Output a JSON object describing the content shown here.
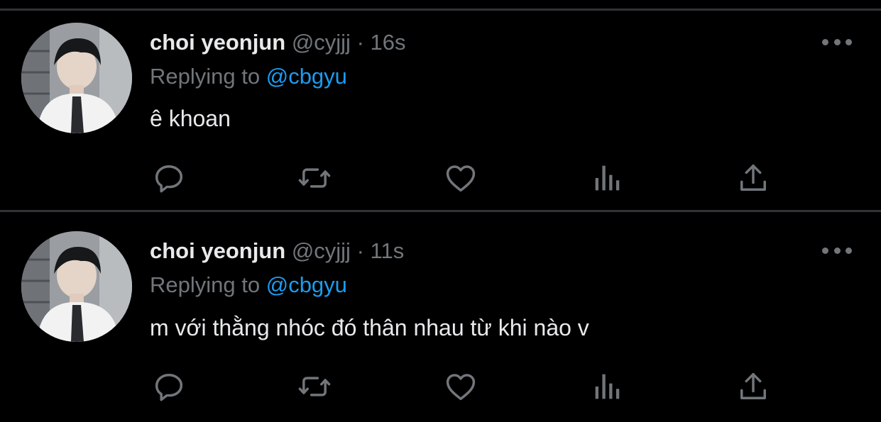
{
  "tweets": [
    {
      "name": "choi yeonjun",
      "handle": "@cyjjj",
      "separator": "·",
      "time": "16s",
      "replying_prefix": "Replying to",
      "replying_to": "@cbgyu",
      "text": "ê khoan"
    },
    {
      "name": "choi yeonjun",
      "handle": "@cyjjj",
      "separator": "·",
      "time": "11s",
      "replying_prefix": "Replying to",
      "replying_to": "@cbgyu",
      "text": "m với thằng nhóc đó thân nhau từ khi nào v"
    }
  ],
  "icons": {
    "reply": "speech-bubble-icon",
    "retweet": "retweet-arrows-icon",
    "like": "heart-outline-icon",
    "views": "bar-chart-icon",
    "share": "upload-arrow-icon",
    "more": "three-dots-icon"
  },
  "colors": {
    "background": "#000000",
    "divider": "#2f3336",
    "primary_text": "#e7e9ea",
    "secondary_text": "#71767b",
    "mention": "#1d9bf0"
  }
}
